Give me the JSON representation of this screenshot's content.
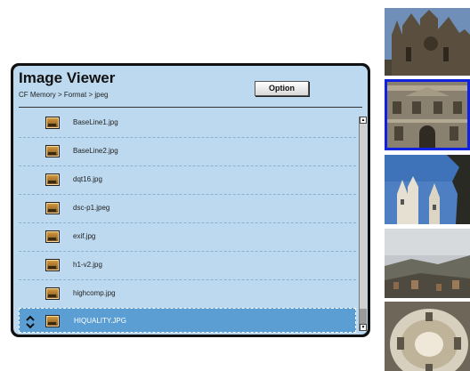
{
  "header": {
    "title": "Image Viewer",
    "breadcrumb": "CF Memory > Format > jpeg",
    "option_label": "Option"
  },
  "files": [
    {
      "name": "BaseLine1.jpg",
      "icon": "image-file-icon"
    },
    {
      "name": "BaseLine2.jpg",
      "icon": "image-file-icon"
    },
    {
      "name": "dqt16.jpg",
      "icon": "image-file-icon"
    },
    {
      "name": "dsc-p1.jpeg",
      "icon": "image-file-icon"
    },
    {
      "name": "exif.jpg",
      "icon": "image-file-icon"
    },
    {
      "name": "h1-v2.jpg",
      "icon": "image-file-icon"
    },
    {
      "name": "highcomp.jpg",
      "icon": "image-file-icon"
    },
    {
      "name": "HIQUALITY.JPG",
      "icon": "image-file-icon",
      "selected": true
    }
  ],
  "thumbnails": [
    {
      "subject": "gothic-cathedral-photo"
    },
    {
      "subject": "baroque-facade-photo",
      "active": true
    },
    {
      "subject": "castle-towers-photo"
    },
    {
      "subject": "city-panorama-photo"
    },
    {
      "subject": "dome-interior-photo"
    }
  ],
  "colors": {
    "panel_bg": "#bdd9ef",
    "selected_row": "#5b9ed3",
    "thumbnail_highlight": "#1022e0"
  }
}
